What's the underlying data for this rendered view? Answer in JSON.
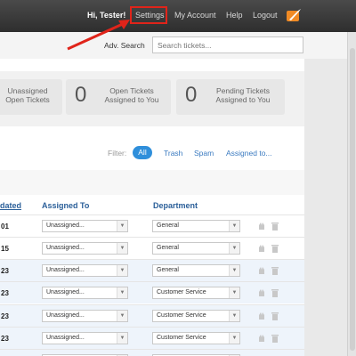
{
  "header": {
    "greeting": "Hi, Tester!",
    "nav": [
      "Settings",
      "My Account",
      "Help",
      "Logout"
    ]
  },
  "search": {
    "label": "Adv. Search",
    "placeholder": "Search tickets..."
  },
  "stats": [
    {
      "number": "",
      "label_line1": "Unassigned",
      "label_line2": "Open Tickets"
    },
    {
      "number": "0",
      "label_line1": "Open Tickets",
      "label_line2": "Assigned to You"
    },
    {
      "number": "0",
      "label_line1": "Pending Tickets",
      "label_line2": "Assigned to You"
    }
  ],
  "filters": {
    "label": "Filter:",
    "active": "All",
    "options": [
      "Trash",
      "Spam",
      "Assigned to..."
    ]
  },
  "table": {
    "headers": {
      "updated": "dated",
      "assigned_to": "Assigned To",
      "department": "Department"
    },
    "rows": [
      {
        "date": "01",
        "assigned": "Unassigned...",
        "department": "General"
      },
      {
        "date": "15",
        "assigned": "Unassigned...",
        "department": "General"
      },
      {
        "date": "23",
        "assigned": "Unassigned...",
        "department": "General"
      },
      {
        "date": "23",
        "assigned": "Unassigned...",
        "department": "Customer Service"
      },
      {
        "date": "23",
        "assigned": "Unassigned...",
        "department": "Customer Service"
      },
      {
        "date": "23",
        "assigned": "Unassigned...",
        "department": "Customer Service"
      },
      {
        "date": "23",
        "assigned": "Unassigned...",
        "department": "Customer Service"
      }
    ]
  },
  "colors": {
    "accent": "#2f8fdb",
    "highlight": "#e0241a",
    "logo": "#f08a24"
  }
}
